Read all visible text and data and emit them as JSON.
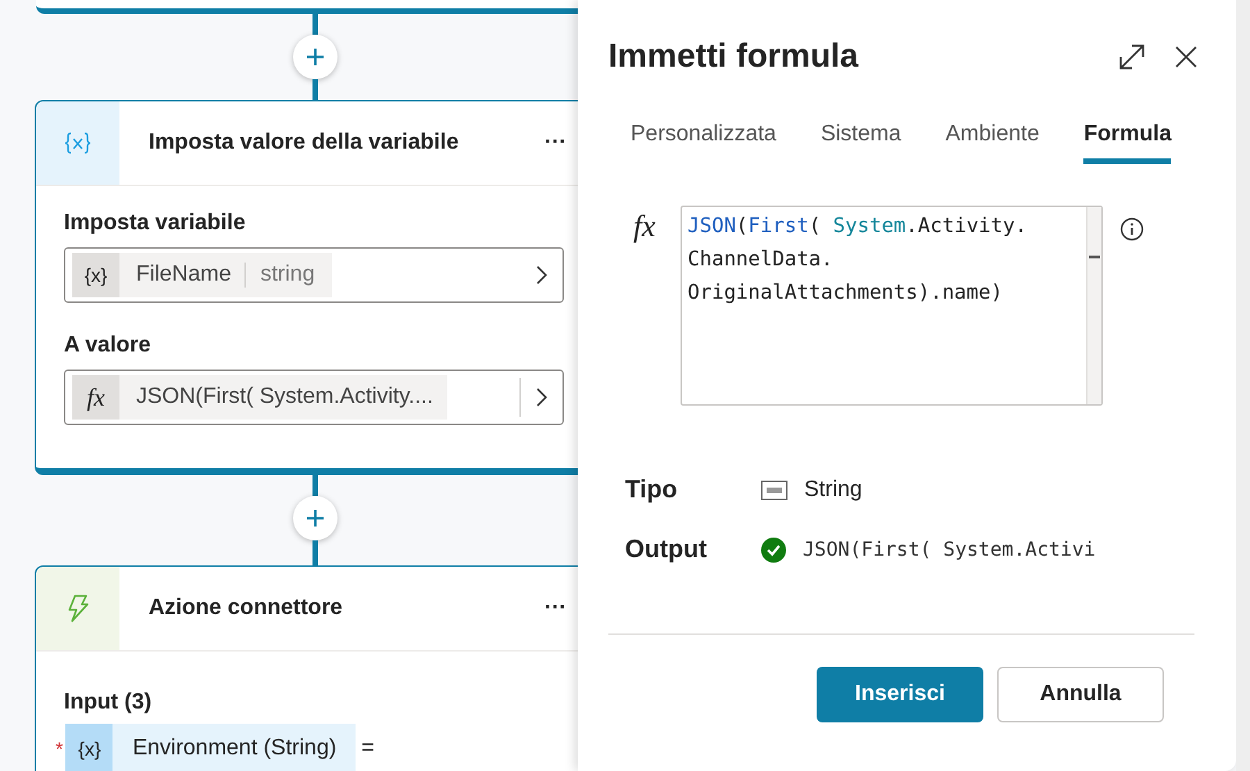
{
  "canvas": {
    "cards": [
      {
        "kind": "variable",
        "title": "Imposta valore della variabile",
        "menu": "···",
        "fields": [
          {
            "label": "Imposta variabile",
            "kind": "variable",
            "icon": "{x}",
            "value": "FileName",
            "type": "string"
          },
          {
            "label": "A valore",
            "kind": "formula",
            "icon": "fx",
            "value": "JSON(First( System.Activity...."
          }
        ]
      },
      {
        "kind": "connector",
        "title": "Azione connettore",
        "menu": "···",
        "section": "Input (3)",
        "inputs": [
          {
            "required": true,
            "required_mark": "*",
            "icon": "{x}",
            "name": "Environment (String)",
            "operator": "="
          }
        ]
      }
    ]
  },
  "panel": {
    "title": "Immetti formula",
    "tabs": [
      {
        "label": "Personalizzata",
        "selected": false
      },
      {
        "label": "Sistema",
        "selected": false
      },
      {
        "label": "Ambiente",
        "selected": false
      },
      {
        "label": "Formula",
        "selected": true
      }
    ],
    "formula": {
      "icon": "fx",
      "lines": [
        [
          {
            "text": "JSON",
            "kind": "function"
          },
          {
            "text": "(",
            "kind": "plain"
          },
          {
            "text": "First",
            "kind": "function"
          },
          {
            "text": "( ",
            "kind": "plain"
          },
          {
            "text": "System",
            "kind": "namespace"
          },
          {
            "text": ".Activity.",
            "kind": "plain"
          }
        ],
        [
          {
            "text": "ChannelData.",
            "kind": "plain"
          }
        ],
        [
          {
            "text": "OriginalAttachments).name)",
            "kind": "plain"
          }
        ]
      ]
    },
    "type_label": "Tipo",
    "type_value": "String",
    "output_label": "Output",
    "output_valid": true,
    "output_value": "JSON(First( System.Activi",
    "buttons": [
      {
        "label": "Inserisci",
        "kind": "primary"
      },
      {
        "label": "Annulla",
        "kind": "secondary"
      }
    ]
  }
}
